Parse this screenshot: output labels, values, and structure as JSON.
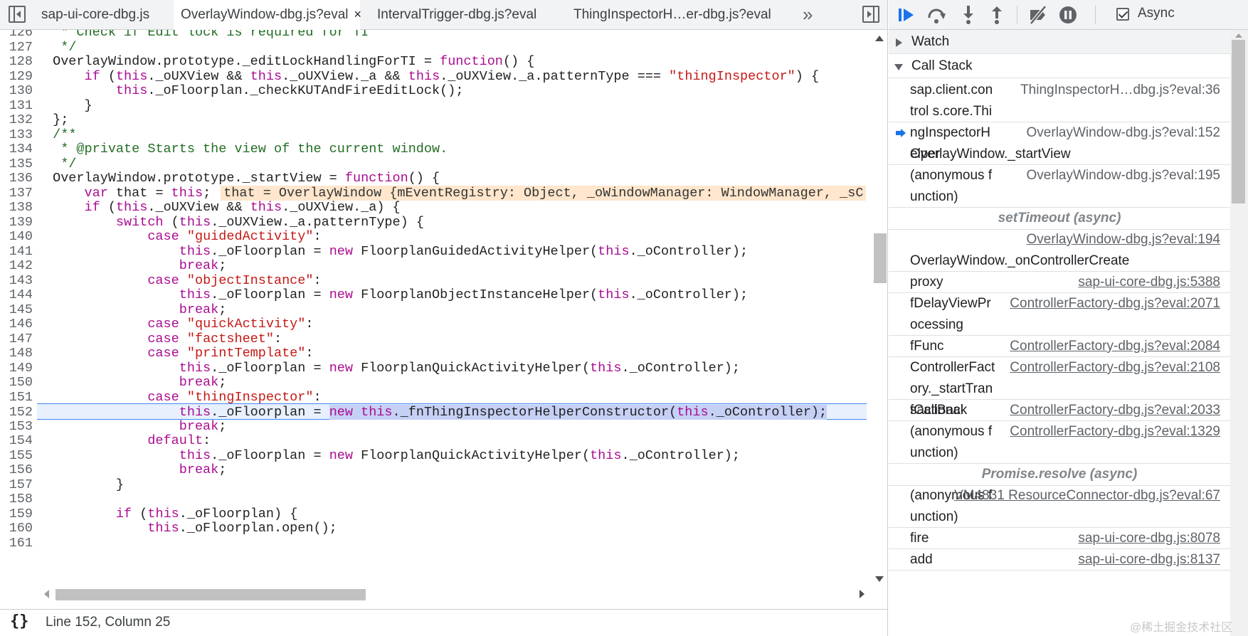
{
  "tabs": [
    {
      "label": "sap-ui-core-dbg.js",
      "active": false
    },
    {
      "label": "OverlayWindow-dbg.js?eval",
      "active": true
    },
    {
      "label": "IntervalTrigger-dbg.js?eval",
      "active": false
    },
    {
      "label": "ThingInspectorH…er-dbg.js?eval",
      "active": false
    }
  ],
  "tab_close_glyph": "×",
  "more_tabs_glyph": "»",
  "status": {
    "position": "Line 152, Column 25",
    "format_glyph": "{}"
  },
  "current_line": 152,
  "code_lines": [
    {
      "n": "126",
      "html": "  <span class=\"cm\">* Check if Edit lock is required for TI</span>"
    },
    {
      "n": "127",
      "html": "  <span class=\"cm\">*/</span>"
    },
    {
      "n": "128",
      "html": " OverlayWindow.prototype._editLockHandlingForTI = <span class=\"kw\">function</span>() {"
    },
    {
      "n": "129",
      "html": "     <span class=\"kw\">if</span> (<span class=\"kw\">this</span>._oUXView &amp;&amp; <span class=\"kw\">this</span>._oUXView._a &amp;&amp; <span class=\"kw\">this</span>._oUXView._a.patternType === <span class=\"str\">\"thingInspector\"</span>) {"
    },
    {
      "n": "130",
      "html": "         <span class=\"kw\">this</span>._oFloorplan._checkKUTAndFireEditLock();"
    },
    {
      "n": "131",
      "html": "     }"
    },
    {
      "n": "132",
      "html": " };"
    },
    {
      "n": "133",
      "html": " <span class=\"cm\">/**</span>"
    },
    {
      "n": "134",
      "html": "  <span class=\"cm\">* @private Starts the view of the current window.</span>"
    },
    {
      "n": "135",
      "html": "  <span class=\"cm\">*/</span>"
    },
    {
      "n": "136",
      "html": " OverlayWindow.prototype._startView = <span class=\"kw\">function</span>() {"
    },
    {
      "n": "137",
      "html": "     <span class=\"kw\">var</span> that = <span class=\"kw\">this</span>;<span class=\"inline-val\">that = OverlayWindow {mEventRegistry: Object, _oWindowManager: WindowManager, _sC</span>"
    },
    {
      "n": "138",
      "html": "     <span class=\"kw\">if</span> (<span class=\"kw\">this</span>._oUXView &amp;&amp; <span class=\"kw\">this</span>._oUXView._a) {"
    },
    {
      "n": "139",
      "html": "         <span class=\"kw\">switch</span> (<span class=\"kw\">this</span>._oUXView._a.patternType) {"
    },
    {
      "n": "140",
      "html": "             <span class=\"kw\">case</span> <span class=\"str\">\"guidedActivity\"</span>:"
    },
    {
      "n": "141",
      "html": "                 <span class=\"kw\">this</span>._oFloorplan = <span class=\"kw\">new</span> FloorplanGuidedActivityHelper(<span class=\"kw\">this</span>._oController);"
    },
    {
      "n": "142",
      "html": "                 <span class=\"kw\">break</span>;"
    },
    {
      "n": "143",
      "html": "             <span class=\"kw\">case</span> <span class=\"str\">\"objectInstance\"</span>:"
    },
    {
      "n": "144",
      "html": "                 <span class=\"kw\">this</span>._oFloorplan = <span class=\"kw\">new</span> FloorplanObjectInstanceHelper(<span class=\"kw\">this</span>._oController);"
    },
    {
      "n": "145",
      "html": "                 <span class=\"kw\">break</span>;"
    },
    {
      "n": "146",
      "html": "             <span class=\"kw\">case</span> <span class=\"str\">\"quickActivity\"</span>:"
    },
    {
      "n": "147",
      "html": "             <span class=\"kw\">case</span> <span class=\"str\">\"factsheet\"</span>:"
    },
    {
      "n": "148",
      "html": "             <span class=\"kw\">case</span> <span class=\"str\">\"printTemplate\"</span>:"
    },
    {
      "n": "149",
      "html": "                 <span class=\"kw\">this</span>._oFloorplan = <span class=\"kw\">new</span> FloorplanQuickActivityHelper(<span class=\"kw\">this</span>._oController);"
    },
    {
      "n": "150",
      "html": "                 <span class=\"kw\">break</span>;"
    },
    {
      "n": "151",
      "html": "             <span class=\"kw\">case</span> <span class=\"str\">\"thingInspector\"</span>:"
    },
    {
      "n": "152",
      "html": "                 <span class=\"kw\">this</span>._oFloorplan = <span class=\"hl\"><span class=\"kw\">new this</span>._fnThingInspectorHelperConstructor(<span class=\"kw\">this</span>._oController);</span>"
    },
    {
      "n": "153",
      "html": "                 <span class=\"kw\">break</span>;"
    },
    {
      "n": "154",
      "html": "             <span class=\"kw\">default</span>:"
    },
    {
      "n": "155",
      "html": "                 <span class=\"kw\">this</span>._oFloorplan = <span class=\"kw\">new</span> FloorplanQuickActivityHelper(<span class=\"kw\">this</span>._oController);"
    },
    {
      "n": "156",
      "html": "                 <span class=\"kw\">break</span>;"
    },
    {
      "n": "157",
      "html": "         }"
    },
    {
      "n": "158",
      "html": ""
    },
    {
      "n": "159",
      "html": "         <span class=\"kw\">if</span> (<span class=\"kw\">this</span>._oFloorplan) {"
    },
    {
      "n": "160",
      "html": "             <span class=\"kw\">this</span>._oFloorplan.open();"
    },
    {
      "n": "161",
      "html": ""
    }
  ],
  "debugger": {
    "async_label": "Async",
    "async_checked": true,
    "watch_label": "Watch",
    "callstack_label": "Call Stack",
    "frames": [
      {
        "type": "frame",
        "fn": "sap.client.control s.core.ThingInspectorHelper",
        "loc": "ThingInspectorH…dbg.js?eval:36",
        "link": false,
        "rows": 2,
        "arrow": false
      },
      {
        "type": "frame",
        "fn": "OverlayWindow._startView",
        "loc": "OverlayWindow-dbg.js?eval:152",
        "link": false,
        "rows": 2,
        "arrow": true
      },
      {
        "type": "frame",
        "fn": "(anonymous function)",
        "loc": "OverlayWindow-dbg.js?eval:195",
        "link": false,
        "rows": 2,
        "arrow": false
      },
      {
        "type": "async",
        "label": "setTimeout (async)"
      },
      {
        "type": "frame",
        "fn": "OverlayWindow._onControllerCreate",
        "loc": "OverlayWindow-dbg.js?eval:194",
        "link": true,
        "rows": 2,
        "arrow": false
      },
      {
        "type": "frame",
        "fn": "proxy",
        "loc": "sap-ui-core-dbg.js:5388",
        "link": true,
        "rows": 1,
        "arrow": false
      },
      {
        "type": "frame",
        "fn": "fDelayViewProcessing",
        "loc": "ControllerFactory-dbg.js?eval:2071",
        "link": true,
        "rows": 2,
        "arrow": false
      },
      {
        "type": "frame",
        "fn": "fFunc",
        "loc": "ControllerFactory-dbg.js?eval:2084",
        "link": true,
        "rows": 1,
        "arrow": false
      },
      {
        "type": "frame",
        "fn": "ControllerFactory._startTransactional",
        "loc": "ControllerFactory-dbg.js?eval:2108",
        "link": true,
        "rows": 2,
        "arrow": false
      },
      {
        "type": "frame",
        "fn": "fCallBack",
        "loc": "ControllerFactory-dbg.js?eval:2033",
        "link": true,
        "rows": 1,
        "arrow": false
      },
      {
        "type": "frame",
        "fn": "(anonymous function)",
        "loc": "ControllerFactory-dbg.js?eval:1329",
        "link": true,
        "rows": 2,
        "arrow": false
      },
      {
        "type": "async",
        "label": "Promise.resolve (async)"
      },
      {
        "type": "frame",
        "fn": "(anonymous function)",
        "loc": "VM4831 ResourceConnector-dbg.js?eval:67",
        "link": true,
        "rows": 2,
        "arrow": false
      },
      {
        "type": "frame",
        "fn": "fire",
        "loc": "sap-ui-core-dbg.js:8078",
        "link": true,
        "rows": 1,
        "arrow": false
      },
      {
        "type": "frame",
        "fn": "add",
        "loc": "sap-ui-core-dbg.js:8137",
        "link": true,
        "rows": 1,
        "arrow": false
      }
    ]
  },
  "colors": {
    "keyword": "#aa0d91",
    "string": "#c41a16",
    "comment": "#236e25",
    "highlight": "#c5d0f5",
    "accent": "#1a73e8"
  },
  "watermark": "@稀土掘金技术社区"
}
